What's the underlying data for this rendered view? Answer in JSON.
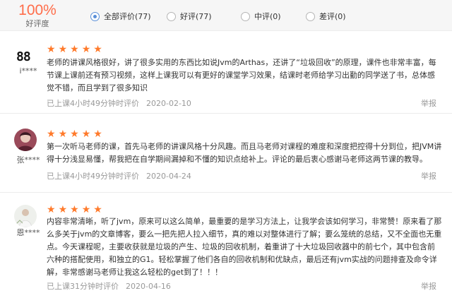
{
  "summary": {
    "rate": "100%",
    "rate_label": "好评度"
  },
  "filters": [
    {
      "label": "全部评价(77)",
      "checked": true
    },
    {
      "label": "好评(77)",
      "checked": false
    },
    {
      "label": "中评(0)",
      "checked": false
    },
    {
      "label": "差评(0)",
      "checked": false
    }
  ],
  "reviews": [
    {
      "avatar_text": "88",
      "username": "i****",
      "stars": 5,
      "content": "老师的讲课风格很好，讲了很多实用的东西比如说Jvm的Arthas，还讲了“垃圾回收”的原理，课件也非常丰富，每节课上课前还有预习视频，这样上课我可以有更好的课堂学习效果，结课时老师给学习出勤的同学送了书，总体感觉不错，而且学到了很多知识",
      "study_time": "已上课4小时49分钟时评价",
      "date": "2020-02-10",
      "report": "举报"
    },
    {
      "avatar_icon": "user-photo-icon",
      "username": "张****",
      "stars": 5,
      "content": "第一次听马老师的课，首先马老师的讲课风格十分风趣。而且马老师对课程的难度和深度把控得十分到位，把JVM讲得十分浅显易懂，帮我把在自学期间漏掉和不懂的知识点给补上。评论的最后衷心感谢马老师这两节课的教导。",
      "study_time": "已上课4小时49分钟时评价",
      "date": "2020-04-24",
      "report": "举报"
    },
    {
      "avatar_icon": "user-photo-icon",
      "username": "恩****",
      "stars": 5,
      "content": "内容非常清晰，听了jvm，原来可以这么简单，最重要的是学习方法上，让我学会该如何学习，非常赞！原来看了那么多关于jvm的文章博客，要么一把先把人拉入细节，真的难以对整体进行了解；要么笼统的总结，又不全面也无重点。今天课程呢，主要收获就是垃圾的产生、垃圾的回收机制，着重讲了十大垃圾回收器中的前七个，其中包含前六种的搭配使用，和独立的G1。轻松掌握了他们各自的回收机制和优缺点，最后还有jvm实战的问题排查及命令详解，非常感谢马老师让我这么轻松的get到了！！！",
      "study_time": "已上课31分钟时评价",
      "date": "2020-04-16",
      "report": "举报"
    }
  ],
  "colors": {
    "accent": "#ff6d4a",
    "star": "#ff7a2b",
    "radio_selected": "#5a8fd8"
  }
}
